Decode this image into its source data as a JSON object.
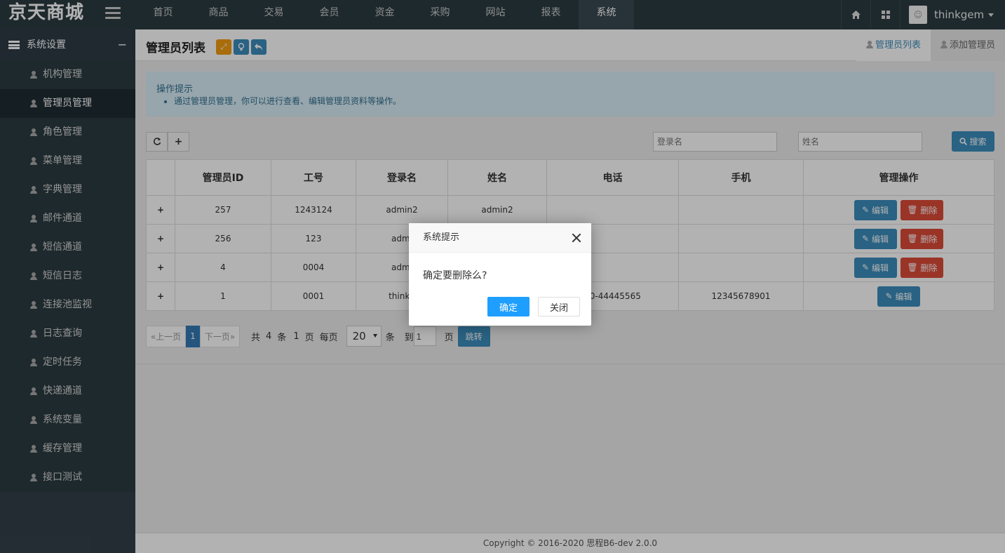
{
  "brand": "京天商城",
  "nav": [
    "首页",
    "商品",
    "交易",
    "会员",
    "资金",
    "采购",
    "网站",
    "报表",
    "系统"
  ],
  "user": {
    "name": "thinkgem"
  },
  "sidebar": {
    "section": "系统设置",
    "items": [
      "机构管理",
      "管理员管理",
      "角色管理",
      "菜单管理",
      "字典管理",
      "邮件通道",
      "短信通道",
      "短信日志",
      "连接池监视",
      "日志查询",
      "定时任务",
      "快递通道",
      "系统变量",
      "缓存管理",
      "接口测试"
    ]
  },
  "page": {
    "title": "管理员列表",
    "tabs": [
      "管理员列表",
      "添加管理员"
    ]
  },
  "tip": {
    "title": "操作提示",
    "items": [
      "通过管理员管理，你可以进行查看、编辑管理员资料等操作。"
    ]
  },
  "search": {
    "login_placeholder": "登录名",
    "name_placeholder": "姓名",
    "button": "搜索"
  },
  "table": {
    "headers": [
      "管理员ID",
      "工号",
      "登录名",
      "姓名",
      "电话",
      "手机",
      "管理操作"
    ],
    "rows": [
      {
        "id": "257",
        "no": "1243124",
        "login": "admin2",
        "name": "admin2",
        "tel": "",
        "mobile": ""
      },
      {
        "id": "256",
        "no": "123",
        "login": "admi",
        "name": "",
        "tel": "",
        "mobile": ""
      },
      {
        "id": "4",
        "no": "0004",
        "login": "admi",
        "name": "",
        "tel": "",
        "mobile": ""
      },
      {
        "id": "1",
        "no": "0001",
        "login": "thinkg",
        "name": "",
        "tel": "10-44445565",
        "mobile": "12345678901"
      }
    ],
    "edit_label": "编辑",
    "delete_label": "删除",
    "expand_symbol": "+"
  },
  "pager": {
    "prev": "«上一页",
    "current": "1",
    "next": "下一页»",
    "total_prefix": "共",
    "total_count": "4",
    "total_unit": "条",
    "pages": "1",
    "pages_unit": "页",
    "per_page": "每页",
    "page_size": "20",
    "size_unit": "条",
    "goto": "到",
    "goto_value": "1",
    "goto_unit": "页",
    "jump": "跳转"
  },
  "footer": "Copyright © 2016-2020  思程B6-dev  2.0.0",
  "dialog": {
    "title": "系统提示",
    "message": "确定要删除么?",
    "ok": "确定",
    "cancel": "关闭"
  },
  "colors": {
    "topbar": "#2c3b41",
    "primary": "#3c8dbc",
    "danger": "#dd4b39",
    "dialog_ok": "#1e9fff"
  }
}
